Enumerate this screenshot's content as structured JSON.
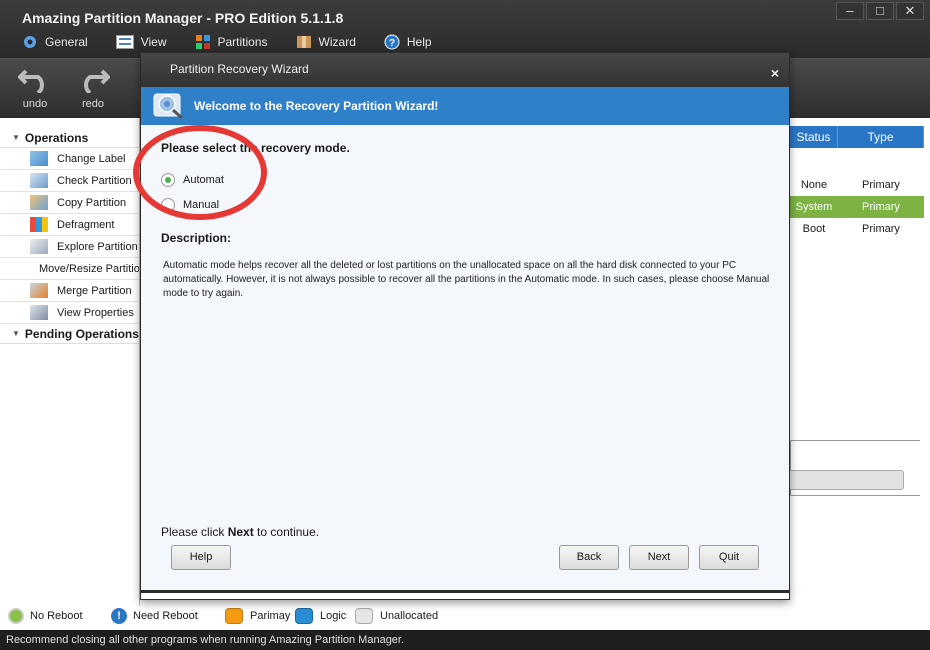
{
  "window": {
    "title": "Amazing Partition Manager - PRO Edition 5.1.1.8",
    "minimize": "–",
    "maximize": "□",
    "close": "✕"
  },
  "menu": [
    "General",
    "View",
    "Partitions",
    "Wizard",
    "Help"
  ],
  "toolbar": {
    "undo": "undo",
    "redo": "redo"
  },
  "left_panel": {
    "operations_title": "Operations",
    "operations": [
      "Change Label",
      "Check Partition",
      "Copy Partition",
      "Defragment",
      "Explore Partition",
      "Move/Resize Partition",
      "Merge Partition",
      "View Properties"
    ],
    "pending_title": "Pending Operations"
  },
  "partition_table": {
    "headers": [
      "Status",
      "Type"
    ],
    "rows": [
      {
        "status": "None",
        "type": "Primary"
      },
      {
        "status": "System",
        "type": "Primary"
      },
      {
        "status": "Boot",
        "type": "Primary"
      }
    ]
  },
  "dialog": {
    "title": "Partition Recovery Wizard",
    "close": "×",
    "banner": "Welcome to the Recovery Partition Wizard!",
    "prompt": "Please select the recovery mode.",
    "options": [
      {
        "label": "Automat",
        "checked": true
      },
      {
        "label": "Manual",
        "checked": false
      }
    ],
    "description_title": "Description:",
    "description": "Automatic mode helps recover all the deleted or lost partitions on the unallocated space on all the hard disk connected to your PC automatically. However, it is not always possible to recover all the partitions in the Automatic mode. In such cases, please choose Manual mode to try again.",
    "continue_prefix": "Please click ",
    "continue_bold": "Next",
    "continue_suffix": " to continue.",
    "buttons": {
      "help": "Help",
      "back": "Back",
      "next": "Next",
      "quit": "Quit"
    }
  },
  "legend": {
    "no_reboot": "No Reboot",
    "need_reboot": "Need Reboot",
    "primary": "Parimay",
    "logic": "Logic",
    "unallocated": "Unallocated"
  },
  "status_bar": "Recommend closing all other programs when running Amazing Partition Manager.",
  "colors": {
    "accent_blue": "#2f80c9",
    "selected_row": "#7cb342",
    "annotation_red": "#e53935",
    "primary_swatch": "#f39c12",
    "logic_swatch": "#2a8dd4",
    "unallocated_swatch": "#e6e6e6"
  }
}
